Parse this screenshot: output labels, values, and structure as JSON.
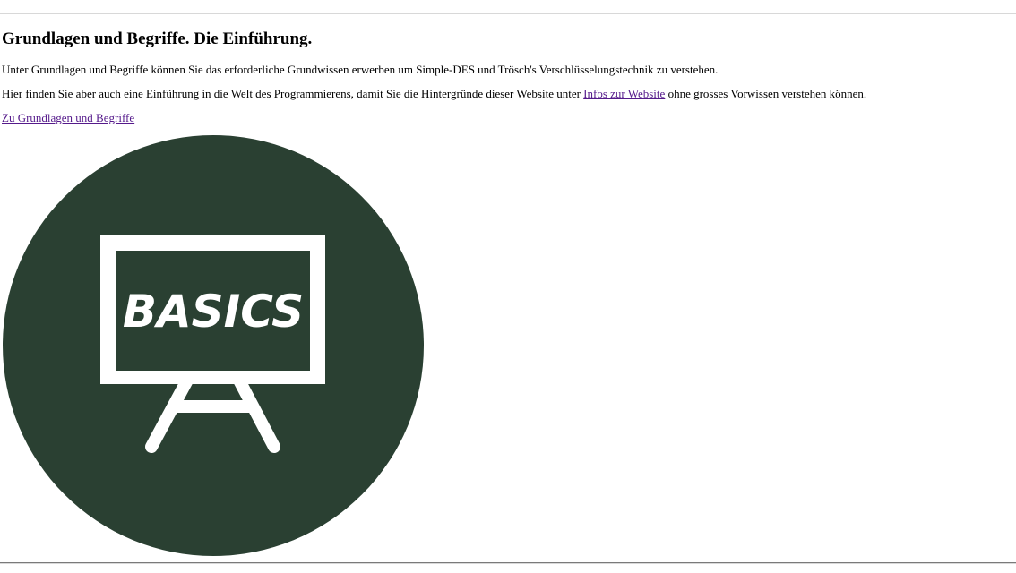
{
  "section": {
    "title": "Grundlagen und Begriffe. Die Einführung.",
    "intro_text": "Unter Grundlagen und Begriffe können Sie das erforderliche Grundwissen erwerben um Simple-DES und Trösch's Verschlüsselungstechnik zu verstehen.",
    "body_text_before_link": "Hier finden Sie aber auch eine Einführung in die Welt des Programmierens, damit Sie die Hintergründe dieser Website unter ",
    "inline_link_label": "Infos zur Website",
    "body_text_after_link": " ohne grosses Vorwissen verstehen können.",
    "main_link_label": "Zu Grundlagen und Begriffe"
  },
  "logo": {
    "icon": "blackboard-icon",
    "text": "BASICS",
    "circle_color": "#2a4032",
    "board_color": "#2a4032",
    "frame_color": "#ffffff"
  },
  "colors": {
    "visited_link": "#551a8b",
    "text": "#000000",
    "rule": "#7a7a7a"
  }
}
